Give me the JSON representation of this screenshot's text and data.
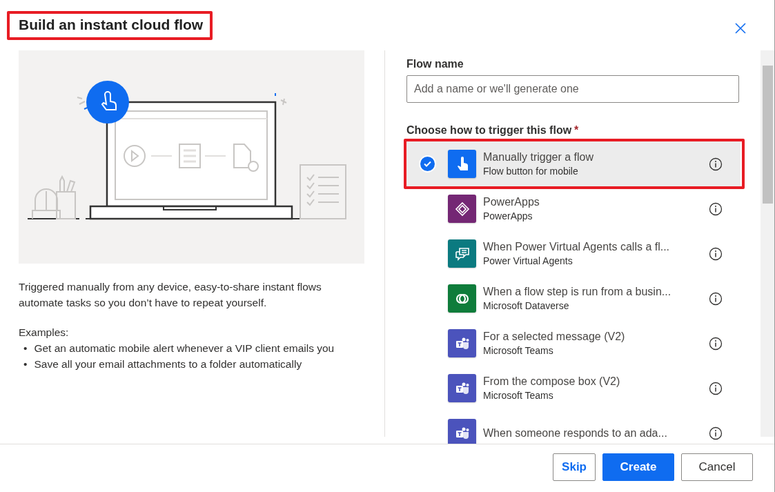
{
  "dialog": {
    "title": "Build an instant cloud flow"
  },
  "description": "Triggered manually from any device, easy-to-share instant flows automate tasks so you don’t have to repeat yourself.",
  "examples": {
    "heading": "Examples:",
    "items": [
      {
        "marker": "•",
        "text": "Get an automatic mobile alert whenever a VIP client emails you"
      },
      {
        "marker": "•",
        "text": "Save all your email attachments to a folder automatically"
      }
    ]
  },
  "flow_name": {
    "label": "Flow name",
    "placeholder": "Add a name or we'll generate one"
  },
  "trigger_section": {
    "label": "Choose how to trigger this flow",
    "required_mark": "*"
  },
  "triggers": [
    {
      "title": "Manually trigger a flow",
      "subtitle": "Flow button for mobile",
      "kind": "hand",
      "color": "#0f6cf0",
      "selected": true
    },
    {
      "title": "PowerApps",
      "subtitle": "PowerApps",
      "kind": "powerapps",
      "color": "#742774",
      "selected": false
    },
    {
      "title": "When Power Virtual Agents calls a fl...",
      "subtitle": "Power Virtual Agents",
      "kind": "chat",
      "color": "#0b7a80",
      "selected": false
    },
    {
      "title": "When a flow step is run from a busin...",
      "subtitle": "Microsoft Dataverse",
      "kind": "dataverse",
      "color": "#0f7c3b",
      "selected": false
    },
    {
      "title": "For a selected message (V2)",
      "subtitle": "Microsoft Teams",
      "kind": "teams",
      "color": "#4b53bc",
      "selected": false
    },
    {
      "title": "From the compose box (V2)",
      "subtitle": "Microsoft Teams",
      "kind": "teams",
      "color": "#4b53bc",
      "selected": false
    },
    {
      "title": "When someone responds to an ada...",
      "kind": "teams",
      "color": "#4b53bc",
      "selected": false
    }
  ],
  "buttons": [
    {
      "label": "Skip",
      "kind": "link"
    },
    {
      "label": "Create",
      "kind": "primary"
    },
    {
      "label": "Cancel",
      "kind": "default"
    }
  ]
}
